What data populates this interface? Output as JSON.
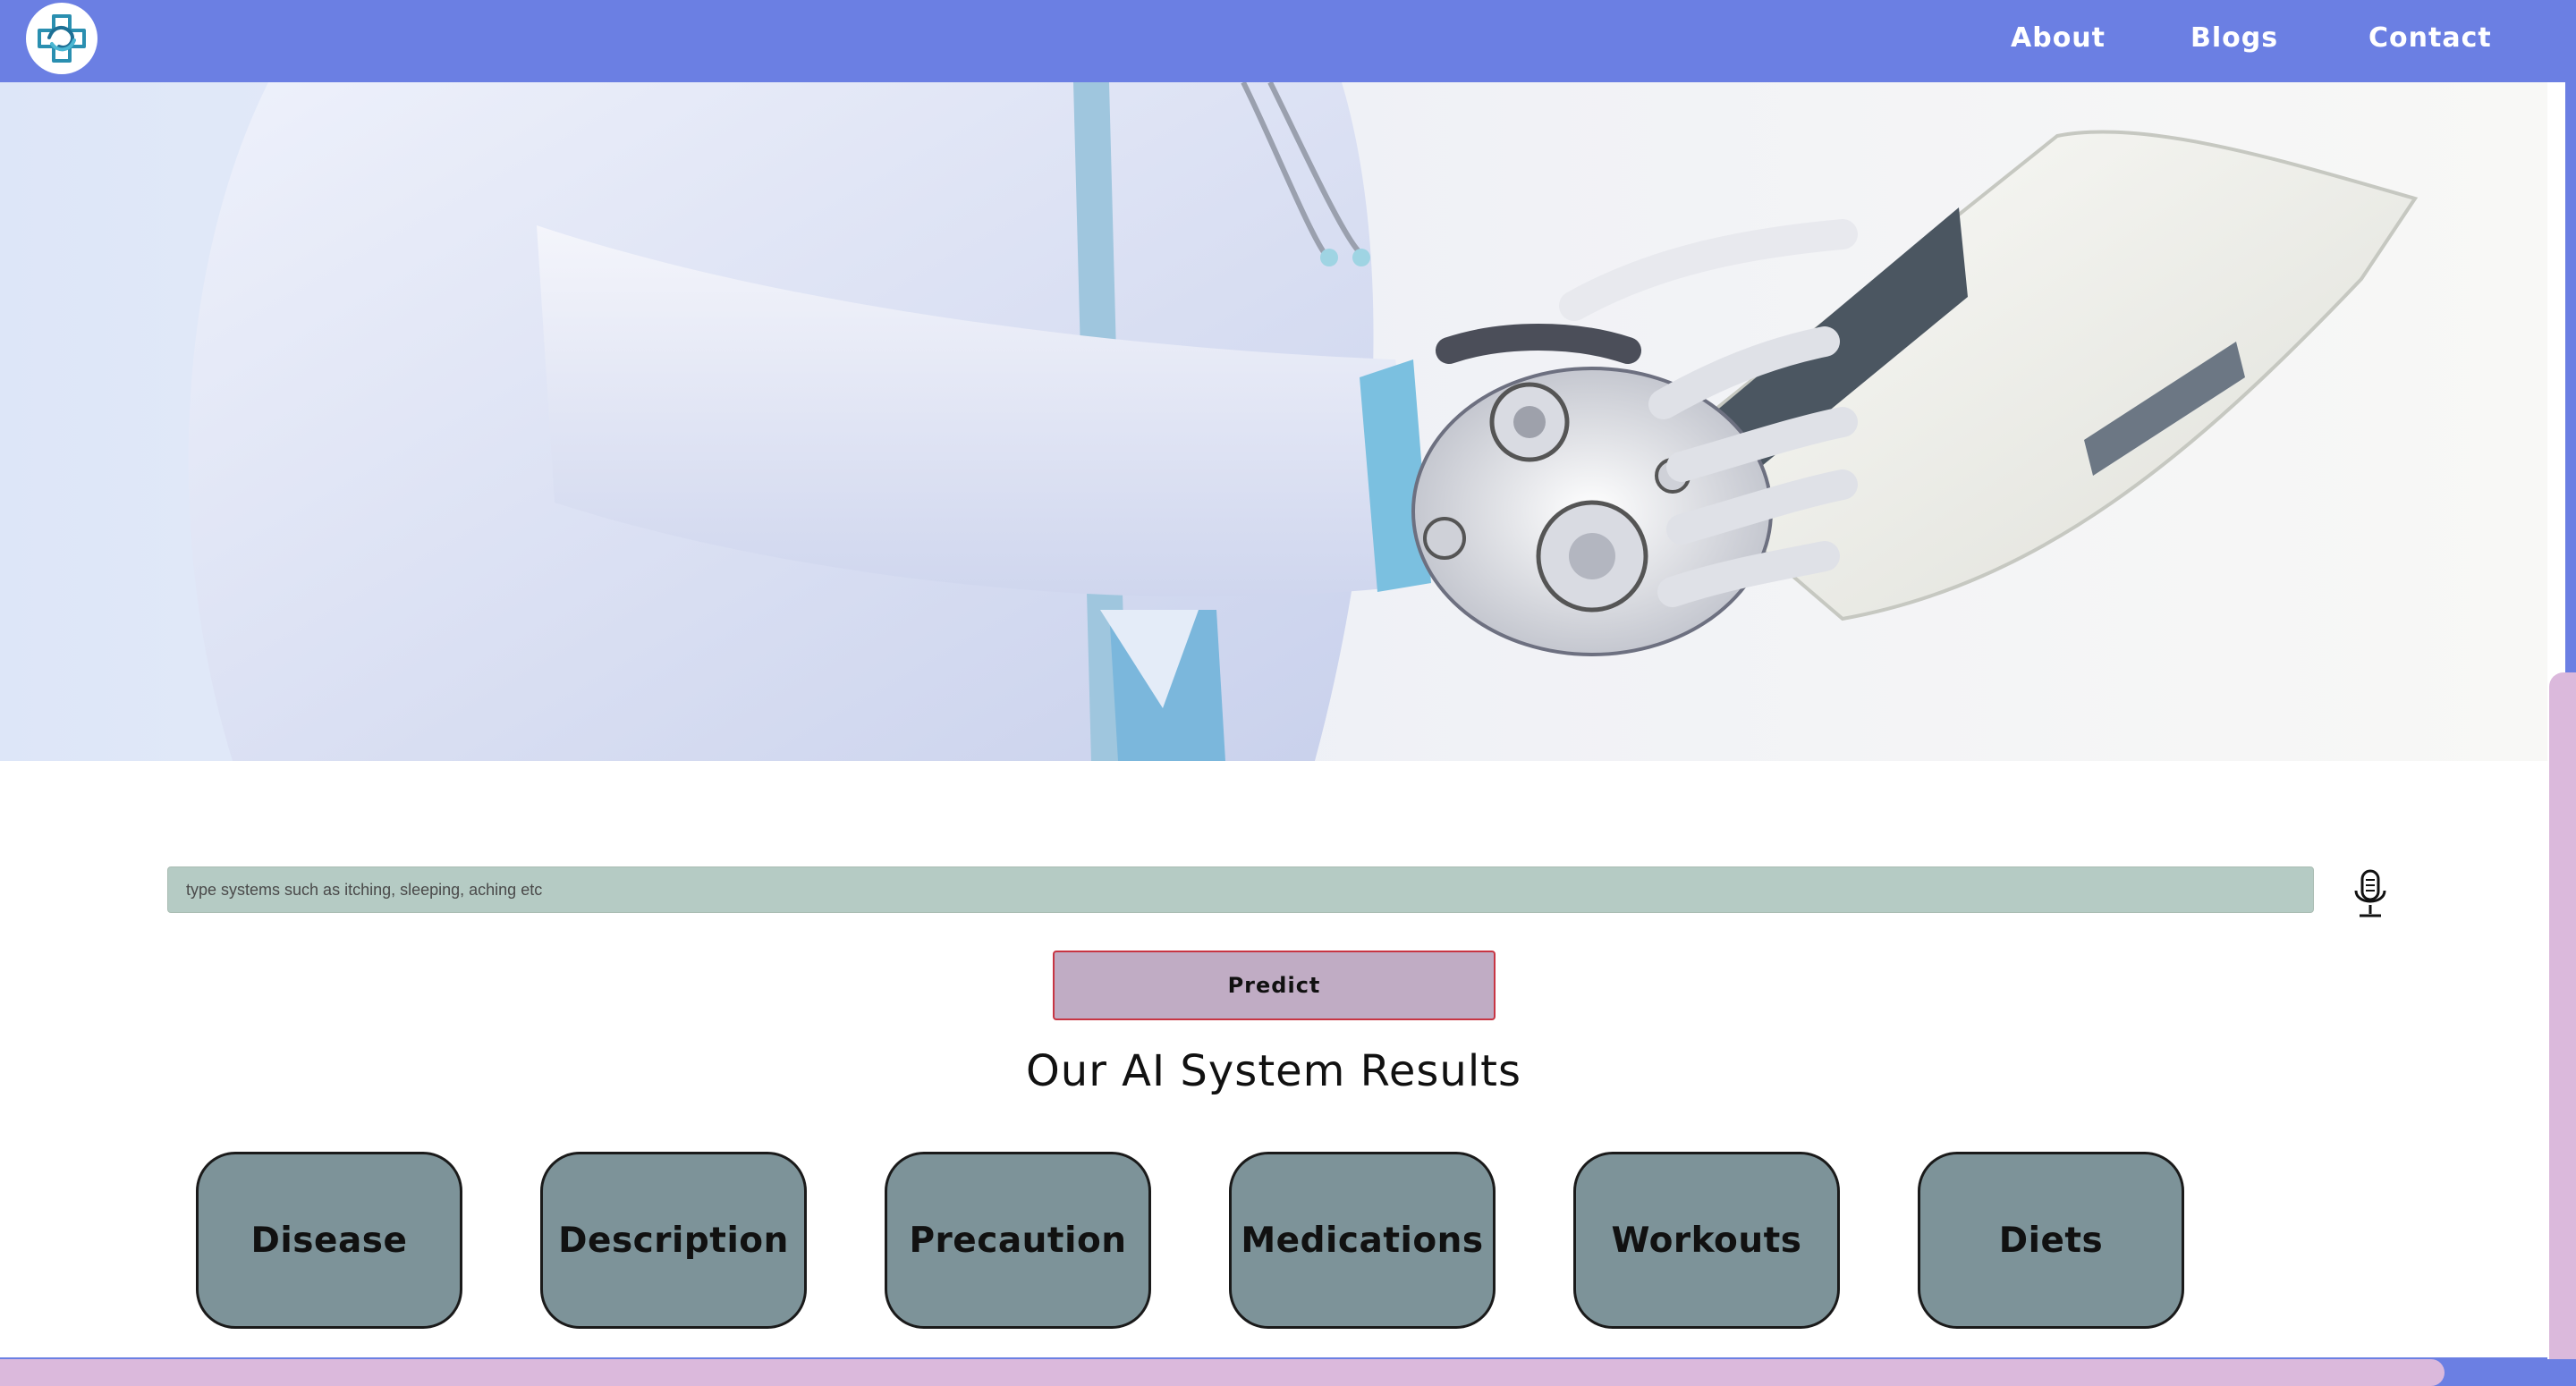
{
  "navbar": {
    "links": [
      {
        "label": "About"
      },
      {
        "label": "Blogs"
      },
      {
        "label": "Contact"
      }
    ],
    "background_color": "#6b7fe3",
    "logo_icon": "medical-cross-logo"
  },
  "hero": {
    "image": "robot-hand-holding-tablet-doctor-coat"
  },
  "search": {
    "placeholder": "type systems such as itching, sleeping, aching etc",
    "value": "",
    "mic_icon": "microphone-icon"
  },
  "predict_button": {
    "label": "Predict"
  },
  "results": {
    "title": "Our AI System Results",
    "buttons": [
      {
        "label": "Disease"
      },
      {
        "label": "Description"
      },
      {
        "label": "Precaution"
      },
      {
        "label": "Medications"
      },
      {
        "label": "Workouts"
      },
      {
        "label": "Diets"
      }
    ]
  },
  "colors": {
    "accent": "#6b7fe3",
    "search_bg": "#b5cbc4",
    "predict_bg": "#c0acc4",
    "predict_border": "#c73543",
    "result_card_bg": "#7d9399",
    "scrollbar_thumb": "#dbb9dc"
  }
}
